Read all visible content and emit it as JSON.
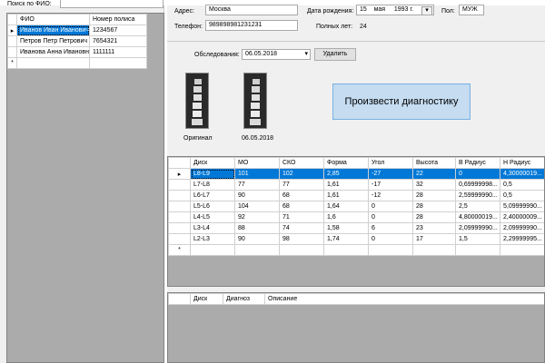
{
  "left": {
    "search_label": "Поиск по ФИО:",
    "search_value": "",
    "patients_columns": [
      "ФИО",
      "Номер полиса"
    ],
    "patients": [
      {
        "name": "Иванов Иван Иванович",
        "policy": "1234567"
      },
      {
        "name": "Петров Петр Петрович",
        "policy": "7654321"
      },
      {
        "name": "Иванова Анна Ивановна",
        "policy": "1111111"
      }
    ],
    "selected_marker": "▸",
    "new_row_marker": "*"
  },
  "patient": {
    "address_label": "Адрес:",
    "address": "Москва",
    "phone_label": "Телефон:",
    "phone": "989898981231231",
    "birth_label": "Дата рождения:",
    "birth_day": "15",
    "birth_month": "мая",
    "birth_year": "1993 г.",
    "gender_label": "Пол:",
    "gender": "МУЖ",
    "age_label": "Полных лет:",
    "age": "24"
  },
  "exam": {
    "label": "Обследования:",
    "selected": "06.05.2018",
    "delete_label": "Удалить"
  },
  "images": [
    {
      "caption": "Оригинал"
    },
    {
      "caption": "06.05.2018"
    }
  ],
  "diagnose_button": "Произвести диагностику",
  "measurements": {
    "columns": [
      "Диск",
      "МО",
      "СКО",
      "Форма",
      "Угол",
      "Высота",
      "В Радиус",
      "Н Радиус"
    ],
    "rows": [
      [
        "L8-L9",
        "101",
        "102",
        "2,85",
        "-27",
        "22",
        "0",
        "4,30000019..."
      ],
      [
        "L7-L8",
        "77",
        "77",
        "1,61",
        "-17",
        "32",
        "0,69999998...",
        "0,5"
      ],
      [
        "L6-L7",
        "90",
        "68",
        "1,61",
        "-12",
        "28",
        "2,59999990...",
        "0,5"
      ],
      [
        "L5-L6",
        "104",
        "68",
        "1,64",
        "0",
        "28",
        "2,5",
        "5,09999990..."
      ],
      [
        "L4-L5",
        "92",
        "71",
        "1,6",
        "0",
        "28",
        "4,80000019...",
        "2,40000009..."
      ],
      [
        "L3-L4",
        "88",
        "74",
        "1,58",
        "6",
        "23",
        "2,09999990...",
        "2,09999990..."
      ],
      [
        "L2-L3",
        "90",
        "98",
        "1,74",
        "0",
        "17",
        "1,5",
        "2,29999995..."
      ]
    ]
  },
  "diagnosis": {
    "columns": [
      "Диск",
      "Диагноз",
      "Описание"
    ]
  }
}
